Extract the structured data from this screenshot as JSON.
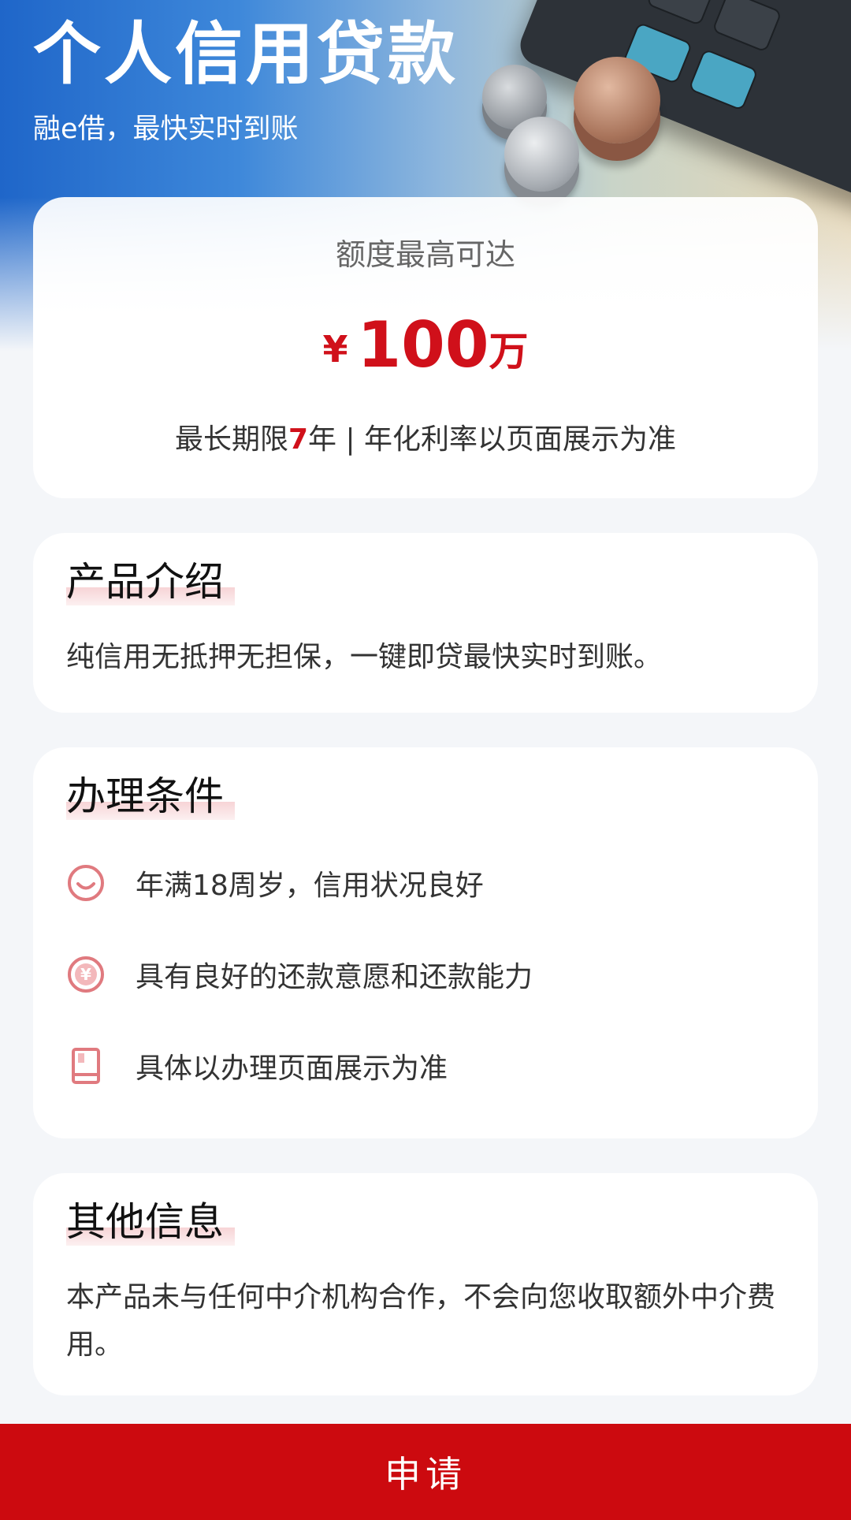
{
  "hero": {
    "title": "个人信用贷款",
    "subtitle": "融e借，最快实时到账"
  },
  "limit_card": {
    "label": "额度最高可达",
    "currency_symbol": "¥",
    "amount": "100",
    "unit": "万",
    "term_prefix": "最长期限",
    "term_years": "7",
    "term_suffix": "年 | 年化利率以页面展示为准"
  },
  "product_intro": {
    "title": "产品介绍",
    "text": "纯信用无抵押无担保，一键即贷最快实时到账。"
  },
  "conditions": {
    "title": "办理条件",
    "items": [
      {
        "icon": "smile-icon",
        "text": "年满18周岁，信用状况良好"
      },
      {
        "icon": "yen-coin-icon",
        "text": "具有良好的还款意愿和还款能力"
      },
      {
        "icon": "book-icon",
        "text": "具体以办理页面展示为准"
      }
    ]
  },
  "other_info": {
    "title": "其他信息",
    "text": "本产品未与任何中介机构合作，不会向您收取额外中介费用。"
  },
  "apply_button": {
    "label": "申请"
  },
  "colors": {
    "brand_red": "#cc0a0f",
    "amount_red": "#d0101a",
    "hero_blue": "#1f66c9",
    "background": "#f4f6f9"
  }
}
